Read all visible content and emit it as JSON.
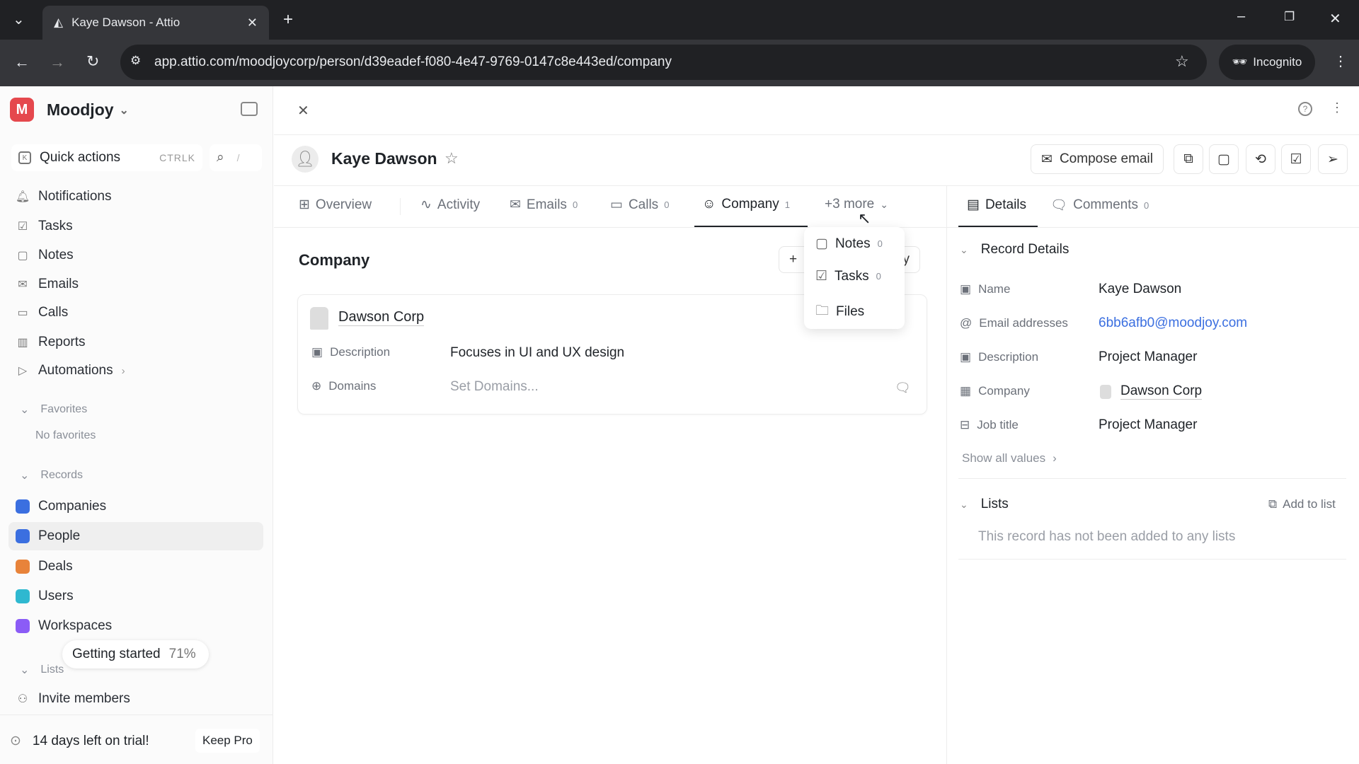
{
  "browser": {
    "tab_title": "Kaye Dawson - Attio",
    "url": "app.attio.com/moodjoycorp/person/d39eadef-f080-4e47-9769-0147c8e443ed/company",
    "incognito_label": "Incognito"
  },
  "sidebar": {
    "workspace_initial": "M",
    "workspace": "Moodjoy",
    "quick_actions": "Quick actions",
    "shortcut": "CTRLK",
    "search_shortcut": "/",
    "nav": [
      {
        "label": "Notifications",
        "icon": "bell-icon"
      },
      {
        "label": "Tasks",
        "icon": "checkbox-icon"
      },
      {
        "label": "Notes",
        "icon": "note-icon"
      },
      {
        "label": "Emails",
        "icon": "mail-icon"
      },
      {
        "label": "Calls",
        "icon": "video-icon"
      },
      {
        "label": "Reports",
        "icon": "chart-icon"
      },
      {
        "label": "Automations",
        "icon": "play-icon"
      }
    ],
    "favorites_header": "Favorites",
    "no_favorites": "No favorites",
    "records_header": "Records",
    "records": [
      {
        "label": "Companies",
        "color": "#3b6fe0"
      },
      {
        "label": "People",
        "color": "#3b6fe0"
      },
      {
        "label": "Deals",
        "color": "#e8833a"
      },
      {
        "label": "Users",
        "color": "#2fb8d0"
      },
      {
        "label": "Workspaces",
        "color": "#8b5cf6"
      }
    ],
    "getting_started": "Getting started",
    "getting_started_progress": "71%",
    "lists_header": "Lists",
    "invite": "Invite members",
    "trial": "14 days left on trial!",
    "keep_pro": "Keep Pro"
  },
  "record": {
    "name": "Kaye Dawson",
    "compose": "Compose email"
  },
  "tabs": [
    {
      "label": "Overview"
    },
    {
      "label": "Activity"
    },
    {
      "label": "Emails",
      "count": "0"
    },
    {
      "label": "Calls",
      "count": "0"
    },
    {
      "label": "Company",
      "count": "1"
    },
    {
      "label": "+3 more"
    }
  ],
  "more_menu": [
    {
      "label": "Notes",
      "count": "0"
    },
    {
      "label": "Tasks",
      "count": "0"
    },
    {
      "label": "Files"
    }
  ],
  "company_section": {
    "title": "Company",
    "add_partial": "y",
    "company_name": "Dawson Corp",
    "description_label": "Description",
    "description": "Focuses in UI and UX design",
    "domains_label": "Domains",
    "domains_placeholder": "Set Domains..."
  },
  "right": {
    "tabs": [
      {
        "label": "Details"
      },
      {
        "label": "Comments",
        "count": "0"
      }
    ],
    "record_details": "Record Details",
    "fields": [
      {
        "label": "Name",
        "value": "Kaye Dawson"
      },
      {
        "label": "Email addresses",
        "value": "6bb6afb0@moodjoy.com"
      },
      {
        "label": "Description",
        "value": "Project Manager"
      },
      {
        "label": "Company",
        "value": "Dawson Corp"
      },
      {
        "label": "Job title",
        "value": "Project Manager"
      }
    ],
    "show_all": "Show all values",
    "lists": "Lists",
    "add_to_list": "Add to list",
    "empty_lists": "This record has not been added to any lists"
  },
  "colors": {
    "link": "#3b6fe0",
    "brand": "#e5484d"
  }
}
